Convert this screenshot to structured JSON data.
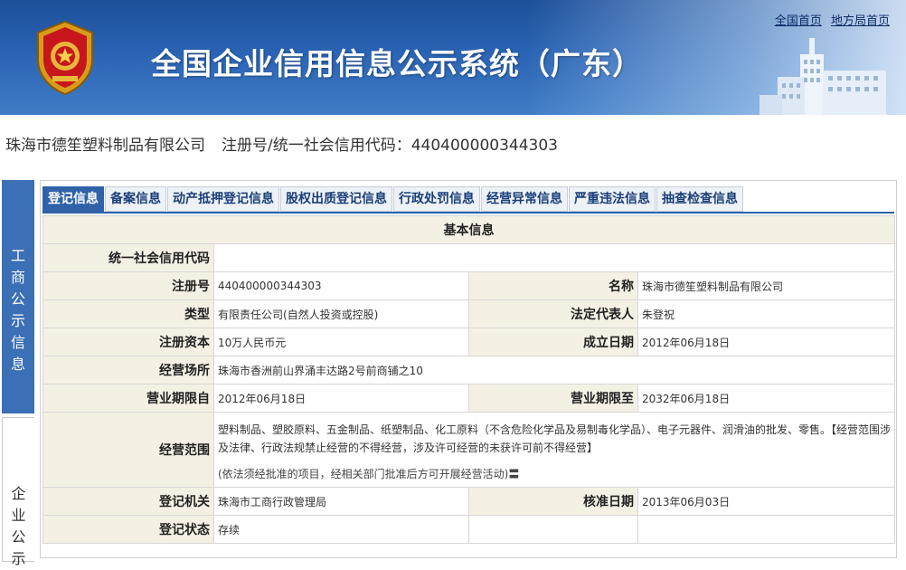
{
  "header": {
    "title": "全国企业信用信息公示系统（广东）",
    "links": [
      "全国首页",
      "地方局首页"
    ]
  },
  "company": {
    "name": "珠海市德笙塑料制品有限公司",
    "reg_label": "注册号/统一社会信用代码：440400000344303"
  },
  "side_nav": {
    "active": "工商公示信息",
    "inactive": "企业公示"
  },
  "tabs": [
    "登记信息",
    "备案信息",
    "动产抵押登记信息",
    "股权出质登记信息",
    "行政处罚信息",
    "经营异常信息",
    "严重违法信息",
    "抽查检查信息"
  ],
  "table": {
    "title": "基本信息",
    "credit_code_label": "统一社会信用代码",
    "credit_code": "",
    "reg_no_label": "注册号",
    "reg_no": "440400000344303",
    "name_label": "名称",
    "name": "珠海市德笙塑料制品有限公司",
    "type_label": "类型",
    "type": "有限责任公司(自然人投资或控股)",
    "legal_rep_label": "法定代表人",
    "legal_rep": "朱登祝",
    "capital_label": "注册资本",
    "capital": "10万人民币元",
    "est_date_label": "成立日期",
    "est_date": "2012年06月18日",
    "address_label": "经营场所",
    "address": "珠海市香洲前山界涌丰达路2号前商铺之10",
    "term_from_label": "营业期限自",
    "term_from": "2012年06月18日",
    "term_to_label": "营业期限至",
    "term_to": "2032年06月18日",
    "scope_label": "经营范围",
    "scope": "塑料制品、塑胶原料、五金制品、纸塑制品、化工原料（不含危险化学品及易制毒化学品）、电子元器件、润滑油的批发、零售。【经营范围涉及法律、行政法规禁止经营的不得经营，涉及许可经营的未获许可前不得经营】",
    "scope_note": "(依法须经批准的项目，经相关部门批准后方可开展经营活动)〓",
    "authority_label": "登记机关",
    "authority": "珠海市工商行政管理局",
    "approval_date_label": "核准日期",
    "approval_date": "2013年06月03日",
    "status_label": "登记状态",
    "status": "存续"
  },
  "colors": {
    "header_blue": "#2a63b3",
    "active_tab": "#2f62a9",
    "label_bg": "#f4f1e4"
  }
}
